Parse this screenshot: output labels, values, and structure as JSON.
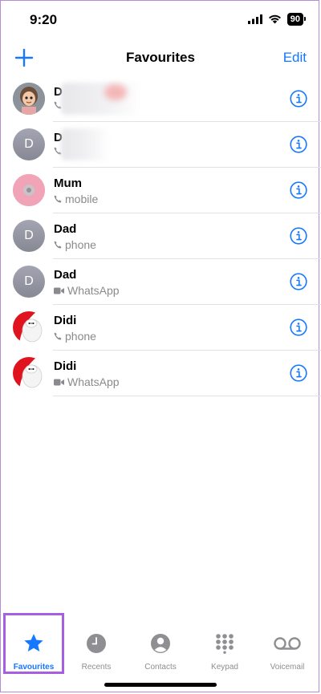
{
  "status_bar": {
    "time": "9:20",
    "battery": "90"
  },
  "nav": {
    "title": "Favourites",
    "edit_label": "Edit"
  },
  "contacts": [
    {
      "name": "D",
      "type": ""
    },
    {
      "name": "D",
      "type": "",
      "initial": "D"
    },
    {
      "name": "Mum",
      "type": "mobile"
    },
    {
      "name": "Dad",
      "type": "phone",
      "initial": "D"
    },
    {
      "name": "Dad",
      "type": "WhatsApp",
      "initial": "D"
    },
    {
      "name": "Didi",
      "type": "phone"
    },
    {
      "name": "Didi",
      "type": "WhatsApp"
    }
  ],
  "tabs": [
    {
      "label": "Favourites",
      "icon": "star-icon",
      "active": true
    },
    {
      "label": "Recents",
      "icon": "clock-icon"
    },
    {
      "label": "Contacts",
      "icon": "person-icon"
    },
    {
      "label": "Keypad",
      "icon": "keypad-icon"
    },
    {
      "label": "Voicemail",
      "icon": "voicemail-icon"
    }
  ],
  "colors": {
    "accent": "#1677ff",
    "highlight": "#a55fe0",
    "secondary_text": "#8a8a8e"
  }
}
